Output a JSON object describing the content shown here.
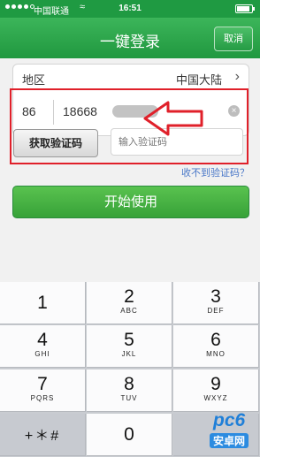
{
  "status_bar": {
    "carrier": "中国联通",
    "time": "16:51",
    "battery_pct": 85
  },
  "nav": {
    "title": "一键登录",
    "cancel_label": "取消"
  },
  "form": {
    "region_label": "地区",
    "region_value": "中国大陆",
    "country_code": "86",
    "phone_visible": "18668",
    "get_code_label": "获取验证码",
    "code_placeholder": "输入验证码",
    "no_code_link": "收不到验证码？",
    "start_label": "开始使用"
  },
  "keypad": {
    "keys": [
      {
        "digit": "1",
        "letters": ""
      },
      {
        "digit": "2",
        "letters": "ABC"
      },
      {
        "digit": "3",
        "letters": "DEF"
      },
      {
        "digit": "4",
        "letters": "GHI"
      },
      {
        "digit": "5",
        "letters": "JKL"
      },
      {
        "digit": "6",
        "letters": "MNO"
      },
      {
        "digit": "7",
        "letters": "PQRS"
      },
      {
        "digit": "8",
        "letters": "TUV"
      },
      {
        "digit": "9",
        "letters": "WXYZ"
      },
      {
        "digit": "+＊#",
        "letters": ""
      },
      {
        "digit": "0",
        "letters": ""
      }
    ]
  },
  "watermark": {
    "text": "pc6",
    "sub": "安卓网"
  },
  "colors": {
    "brand_green": "#20983f",
    "highlight_red": "#e0202a",
    "link_blue": "#4a78c8"
  }
}
